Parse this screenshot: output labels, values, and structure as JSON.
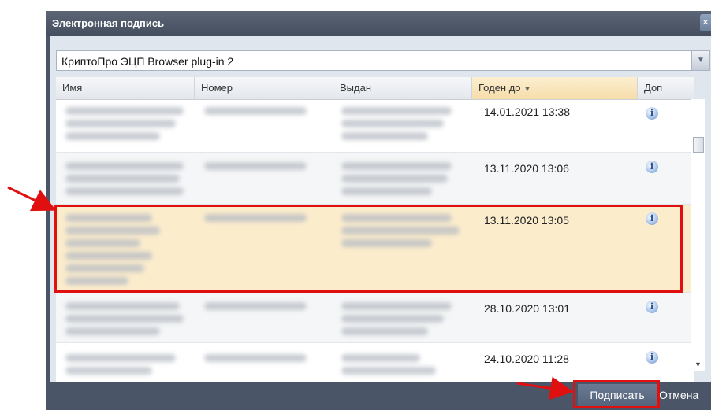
{
  "dialog": {
    "title": "Электронная подпись",
    "close_icon": "close-icon"
  },
  "plugin": {
    "selected": "КриптоПро ЭЦП Browser plug-in 2"
  },
  "table": {
    "columns": [
      {
        "label": "Имя"
      },
      {
        "label": "Номер"
      },
      {
        "label": "Выдан"
      },
      {
        "label": "Годен до",
        "sort": "desc"
      },
      {
        "label": "Доп"
      }
    ],
    "rows": [
      {
        "valid_to": "14.01.2021 13:38",
        "selected": false
      },
      {
        "valid_to": "13.11.2020 13:06",
        "selected": false
      },
      {
        "valid_to": "13.11.2020 13:05",
        "selected": true
      },
      {
        "valid_to": "28.10.2020 13:01",
        "selected": false
      },
      {
        "valid_to": "24.10.2020 11:28",
        "selected": false
      }
    ]
  },
  "footer": {
    "sign_label": "Подписать",
    "cancel_label": "Отмена"
  },
  "colors": {
    "title_bar": "#4a5668",
    "selected_row": "#fbeccc",
    "annotation": "#e01010"
  }
}
